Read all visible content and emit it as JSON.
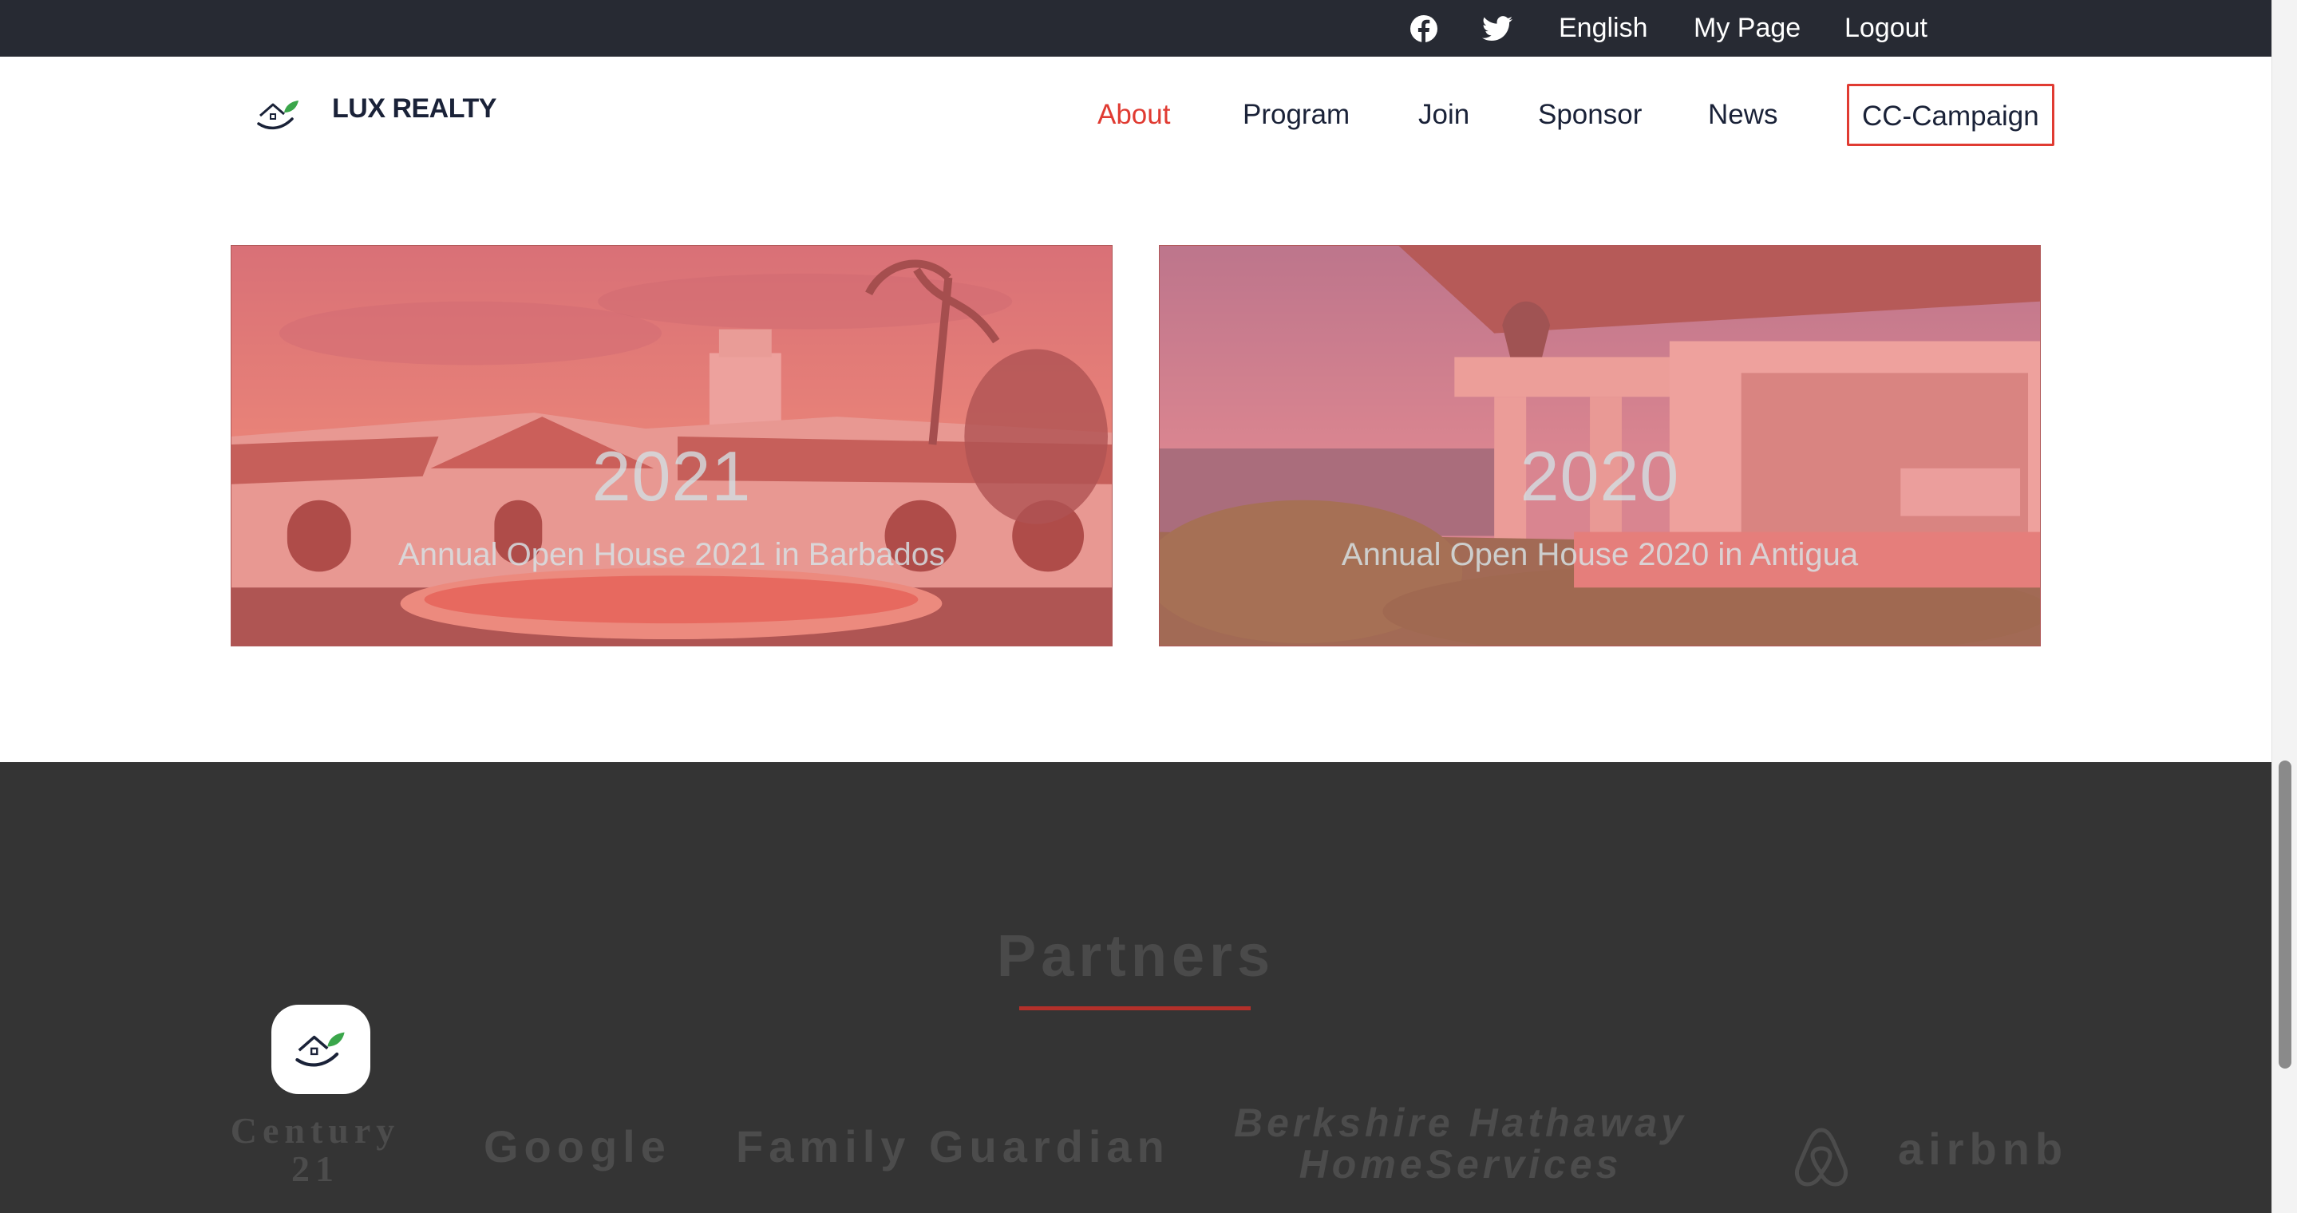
{
  "topbar": {
    "icons": [
      "facebook-icon",
      "twitter-icon"
    ],
    "language": "English",
    "my_page": "My Page",
    "logout": "Logout"
  },
  "brand": {
    "name": "LUX REALTY",
    "icon": "house-leaf-logo-icon"
  },
  "nav": {
    "items": [
      "About",
      "Program",
      "Join",
      "Sponsor",
      "News",
      "CC-Campaign"
    ],
    "active": "About"
  },
  "events": [
    {
      "year": "2021",
      "caption": "Annual Open House 2021 in Barbados"
    },
    {
      "year": "2020",
      "caption": "Annual Open House 2020 in Antigua"
    }
  ],
  "partners": {
    "title": "Partners",
    "logos": {
      "century21": "Century 21",
      "google": "Google",
      "family_guardian": "Family Guardian",
      "berkshire": "Berkshire Hathaway HomeServices",
      "airbnb": "airbnb"
    }
  },
  "colors": {
    "accent": "#e03b32",
    "topbar": "#272a33",
    "navy": "#1a2238",
    "footer": "#343434"
  }
}
